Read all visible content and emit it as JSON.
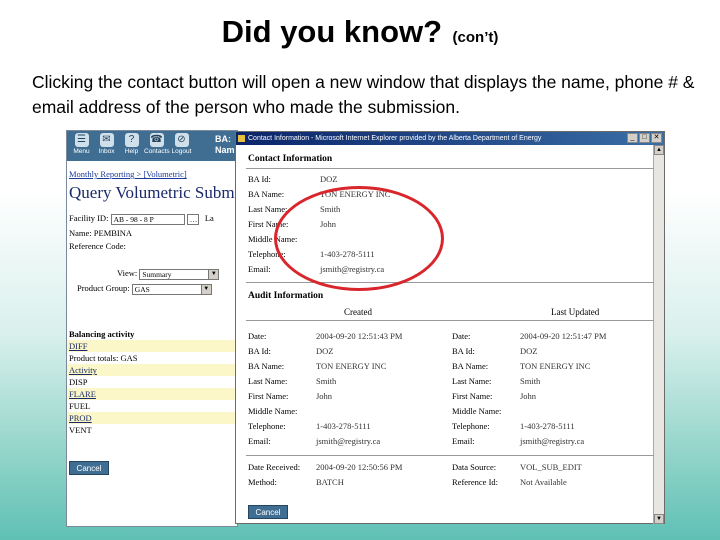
{
  "slide": {
    "title": "Did you know?",
    "title_suffix": "(con’t)",
    "body": "Clicking the contact button will open a new window that displays the name, phone # & email address of the person who made the submission."
  },
  "app": {
    "nav": [
      {
        "label": "Menu",
        "icon": "menu-icon"
      },
      {
        "label": "Inbox",
        "icon": "inbox-icon"
      },
      {
        "label": "Help",
        "icon": "help-icon"
      },
      {
        "label": "Contacts",
        "icon": "contacts-icon"
      },
      {
        "label": "Logout",
        "icon": "logout-icon"
      }
    ],
    "ba_label": "BA:",
    "name_label": "Nam",
    "breadcrumb": "Monthly Reporting > [Volumetric]",
    "title": "Query Volumetric Submi",
    "facility_label": "Facility ID:",
    "facility_value": "AB - 98 - 8 P",
    "facility_suffix": "La",
    "name_row": "Name:  PEMBINA",
    "reference_label": "Reference Code:",
    "view_label": "View:",
    "view_value": "Summary",
    "product_group_label": "Product Group:",
    "product_group_value": "GAS",
    "balancing_rows": [
      {
        "text": "Balancing activity",
        "style": "hdr"
      },
      {
        "text": "DIFF",
        "style": "y"
      },
      {
        "text": "Product totals: GAS",
        "style": "w"
      },
      {
        "text": "Activity",
        "style": "y"
      },
      {
        "text": "DISP",
        "style": "w"
      },
      {
        "text": "FLARE",
        "style": "y"
      },
      {
        "text": "FUEL",
        "style": "w"
      },
      {
        "text": "PROD",
        "style": "y"
      },
      {
        "text": "VENT",
        "style": "w"
      }
    ],
    "cancel_label": "Cancel"
  },
  "popup": {
    "window_title": "Contact Information - Microsoft Internet Explorer provided by the Alberta Department of Energy",
    "contact_heading": "Contact Information",
    "contact_fields": [
      {
        "label": "BA Id:",
        "value": "DOZ"
      },
      {
        "label": "BA Name:",
        "value": "TON ENERGY INC"
      },
      {
        "label": "Last Name:",
        "value": "Smith"
      },
      {
        "label": "First Name:",
        "value": "John"
      },
      {
        "label": "Middle Name:",
        "value": ""
      },
      {
        "label": "Telephone:",
        "value": "1-403-278-5111"
      },
      {
        "label": "Email:",
        "value": "jsmith@registry.ca"
      }
    ],
    "audit_heading": "Audit Information",
    "created_heading": "Created",
    "updated_heading": "Last Updated",
    "created_fields": [
      {
        "label": "Date:",
        "value": "2004-09-20 12:51:43 PM"
      },
      {
        "label": "BA Id:",
        "value": "DOZ"
      },
      {
        "label": "BA Name:",
        "value": "TON ENERGY INC"
      },
      {
        "label": "Last Name:",
        "value": "Smith"
      },
      {
        "label": "First Name:",
        "value": "John"
      },
      {
        "label": "Middle Name:",
        "value": ""
      },
      {
        "label": "Telephone:",
        "value": "1-403-278-5111"
      },
      {
        "label": "Email:",
        "value": "jsmith@registry.ca"
      }
    ],
    "updated_fields": [
      {
        "label": "Date:",
        "value": "2004-09-20 12:51:47 PM"
      },
      {
        "label": "BA Id:",
        "value": "DOZ"
      },
      {
        "label": "BA Name:",
        "value": "TON ENERGY INC"
      },
      {
        "label": "Last Name:",
        "value": "Smith"
      },
      {
        "label": "First Name:",
        "value": "John"
      },
      {
        "label": "Middle Name:",
        "value": ""
      },
      {
        "label": "Telephone:",
        "value": "1-403-278-5111"
      },
      {
        "label": "Email:",
        "value": "jsmith@registry.ca"
      }
    ],
    "date_received_label": "Date Received:",
    "date_received_value": "2004-09-20 12:50:56 PM",
    "method_label": "Method:",
    "method_value": "BATCH",
    "data_source_label": "Data Source:",
    "data_source_value": "VOL_SUB_EDIT",
    "reference_id_label": "Reference Id:",
    "reference_id_value": "Not Available",
    "cancel_label": "Cancel"
  },
  "colors": {
    "nav_bar": "#3f6e92",
    "highlight": "#d8262c",
    "row_highlight": "#fbf7c8"
  }
}
